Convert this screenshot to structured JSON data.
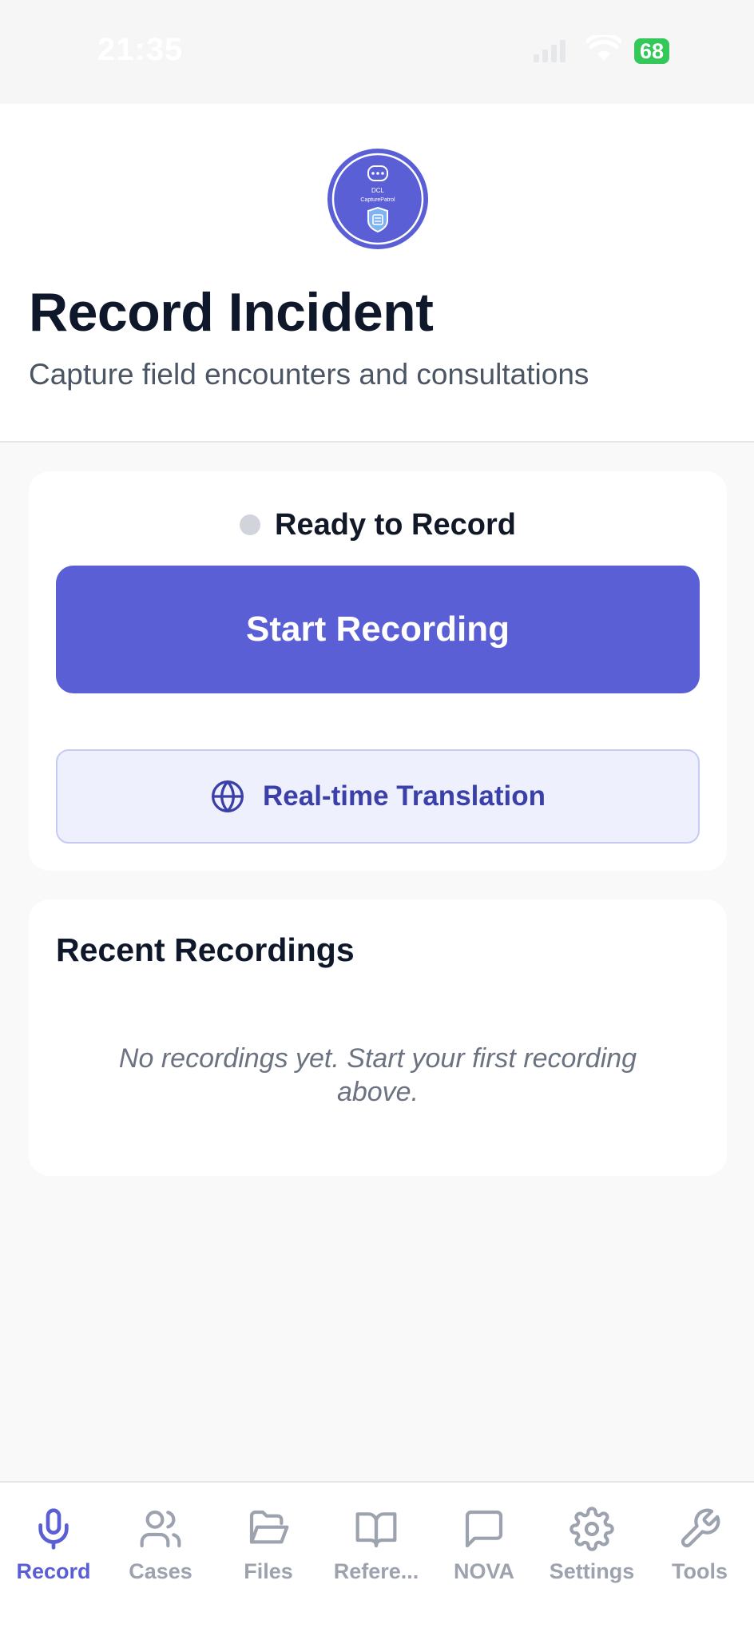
{
  "status_bar": {
    "time": "21:35",
    "battery": "68"
  },
  "header": {
    "logo_text_top": "DCL",
    "logo_text_bottom": "CapturePatrol",
    "title": "Record Incident",
    "subtitle": "Capture field encounters and consultations"
  },
  "record_card": {
    "status": "Ready to Record",
    "start_label": "Start Recording",
    "translation_label": "Real-time Translation"
  },
  "recent": {
    "title": "Recent Recordings",
    "empty_message": "No recordings yet. Start your first recording above."
  },
  "tabs": [
    {
      "label": "Record",
      "icon": "microphone-icon",
      "active": true
    },
    {
      "label": "Cases",
      "icon": "users-icon",
      "active": false
    },
    {
      "label": "Files",
      "icon": "folder-icon",
      "active": false
    },
    {
      "label": "Refere...",
      "icon": "book-icon",
      "active": false
    },
    {
      "label": "NOVA",
      "icon": "chat-icon",
      "active": false
    },
    {
      "label": "Settings",
      "icon": "gear-icon",
      "active": false
    },
    {
      "label": "Tools",
      "icon": "wrench-icon",
      "active": false
    }
  ],
  "colors": {
    "accent": "#5b5fd6",
    "inactive_tab": "#9ca3af",
    "battery": "#34c759"
  }
}
